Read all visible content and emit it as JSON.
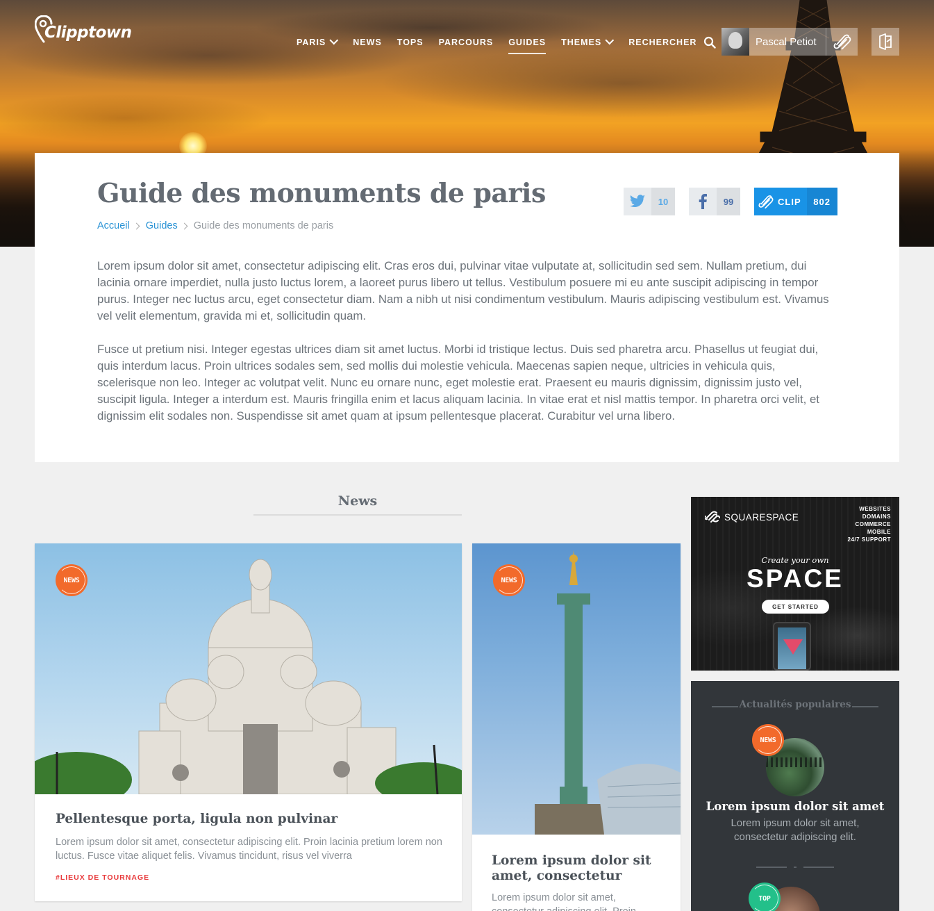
{
  "header": {
    "logo_text": "Clipptown",
    "nav": [
      {
        "label": "Paris",
        "has_dropdown": true
      },
      {
        "label": "News"
      },
      {
        "label": "Tops"
      },
      {
        "label": "Parcours"
      },
      {
        "label": "Guides",
        "active": true
      },
      {
        "label": "Themes",
        "has_dropdown": true
      },
      {
        "label": "Rechercher",
        "icon": "search-icon"
      }
    ],
    "user": {
      "name": "Pascal Petiot",
      "icon": "paperclip-icon"
    },
    "exit_icon": "logout-icon"
  },
  "page": {
    "title": "Guide des monuments de paris",
    "breadcrumb": [
      "Accueil",
      "Guides",
      "Guide des monuments de paris"
    ],
    "share": {
      "twitter_count": "10",
      "facebook_count": "99",
      "clip_label": "CLIP",
      "clip_count": "802"
    },
    "paragraphs": [
      "Lorem ipsum dolor sit amet, consectetur adipiscing elit. Cras eros dui, pulvinar vitae vulputate at, sollicitudin sed sem. Nullam pretium, dui lacinia ornare imperdiet, nulla justo luctus lorem, a laoreet purus libero ut tellus. Vestibulum posuere mi eu ante suscipit adipiscing in tempor purus. Integer nec luctus arcu, eget consectetur diam. Nam a nibh ut nisi condimentum vestibulum. Mauris adipiscing vestibulum est. Vivamus vel velit elementum, gravida mi et, sollicitudin quam.",
      "Fusce ut pretium nisi. Integer egestas ultrices diam sit amet luctus. Morbi id tristique lectus. Duis sed pharetra arcu. Phasellus ut feugiat dui, quis interdum lacus. Proin ultrices sodales sem, sed mollis dui molestie vehicula. Maecenas sapien neque, ultricies in vehicula quis, scelerisque non leo. Integer ac volutpat velit. Nunc eu ornare nunc, eget molestie erat. Praesent eu mauris dignissim, dignissim justo vel, suscipit ligula. Integer a interdum est. Mauris fringilla enim et lacus aliquam lacinia. In vitae erat et nisl mattis tempor. In pharetra orci velit, et dignissim elit sodales non. Suspendisse sit amet quam at ipsum pellentesque placerat. Curabitur vel urna libero."
    ]
  },
  "news": {
    "heading": "News",
    "cards": [
      {
        "badge": "NEWS",
        "title": "Pellentesque porta, ligula non pulvinar",
        "text": "Lorem ipsum dolor sit amet, consectetur adipiscing elit. Proin lacinia pretium lorem non luctus. Fusce vitae aliquet felis. Vivamus tincidunt, risus vel viverra",
        "tag": "#Lieux de tournage"
      },
      {
        "badge": "NEWS",
        "title": "Lorem ipsum dolor sit amet, consectetur",
        "text": "Lorem ipsum dolor sit amet, consectetur adipiscing elit. Proin"
      }
    ]
  },
  "ad": {
    "brand": "SQUARESPACE",
    "features": [
      "WEBSITES",
      "DOMAINS",
      "COMMERCE",
      "MOBILE",
      "24/7 SUPPORT"
    ],
    "tagline": "Create your own",
    "headline": "SPACE",
    "cta": "GET STARTED"
  },
  "popular": {
    "heading": "Actualités populaires",
    "item": {
      "badge": "NEWS",
      "title": "Lorem ipsum dolor sit amet",
      "text": "Lorem ipsum dolor sit amet, consectetur adipiscing elit."
    },
    "next_badge": "TOP"
  },
  "colors": {
    "accent_blue": "#1993e6",
    "link_blue": "#2a93d5",
    "news_orange": "#f26a2b",
    "top_green": "#23c08a",
    "tag_red": "#e8393b"
  }
}
